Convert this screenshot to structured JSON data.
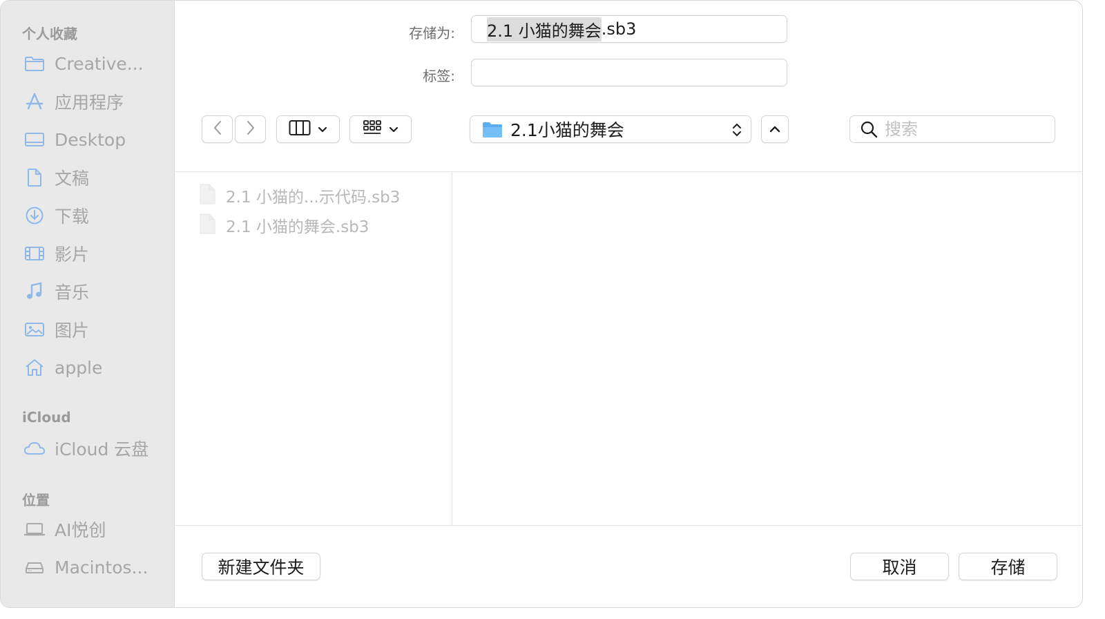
{
  "sidebar": {
    "sections": {
      "favorites": "个人收藏",
      "icloud": "iCloud",
      "locations": "位置"
    },
    "favorites": [
      {
        "label": "Creative...",
        "icon": "folder-icon"
      },
      {
        "label": "应用程序",
        "icon": "applications-icon"
      },
      {
        "label": "Desktop",
        "icon": "desktop-icon"
      },
      {
        "label": "文稿",
        "icon": "document-icon"
      },
      {
        "label": "下载",
        "icon": "download-icon"
      },
      {
        "label": "影片",
        "icon": "movies-icon"
      },
      {
        "label": "音乐",
        "icon": "music-icon"
      },
      {
        "label": "图片",
        "icon": "pictures-icon"
      },
      {
        "label": "apple",
        "icon": "home-icon"
      }
    ],
    "icloud": [
      {
        "label": "iCloud 云盘",
        "icon": "cloud-icon"
      }
    ],
    "locations": [
      {
        "label": "AI悦创",
        "icon": "laptop-icon"
      },
      {
        "label": "Macintos...",
        "icon": "disk-icon"
      }
    ]
  },
  "form": {
    "save_as_label": "存储为:",
    "save_as_selected": "2.1 小猫的舞会",
    "save_as_extension": ".sb3",
    "tags_label": "标签:",
    "tags_value": ""
  },
  "toolbar": {
    "location": "2.1小猫的舞会",
    "search_placeholder": "搜索"
  },
  "files": [
    {
      "name": "2.1 小猫的...示代码.sb3"
    },
    {
      "name": "2.1 小猫的舞会.sb3"
    }
  ],
  "buttons": {
    "new_folder": "新建文件夹",
    "cancel": "取消",
    "save": "存储"
  },
  "colors": {
    "sidebar_bg": "#e9e9e9",
    "sidebar_icon": "#8fb8e8",
    "folder_blue": "#5aaef0",
    "disabled_text": "#b8b8b8"
  }
}
